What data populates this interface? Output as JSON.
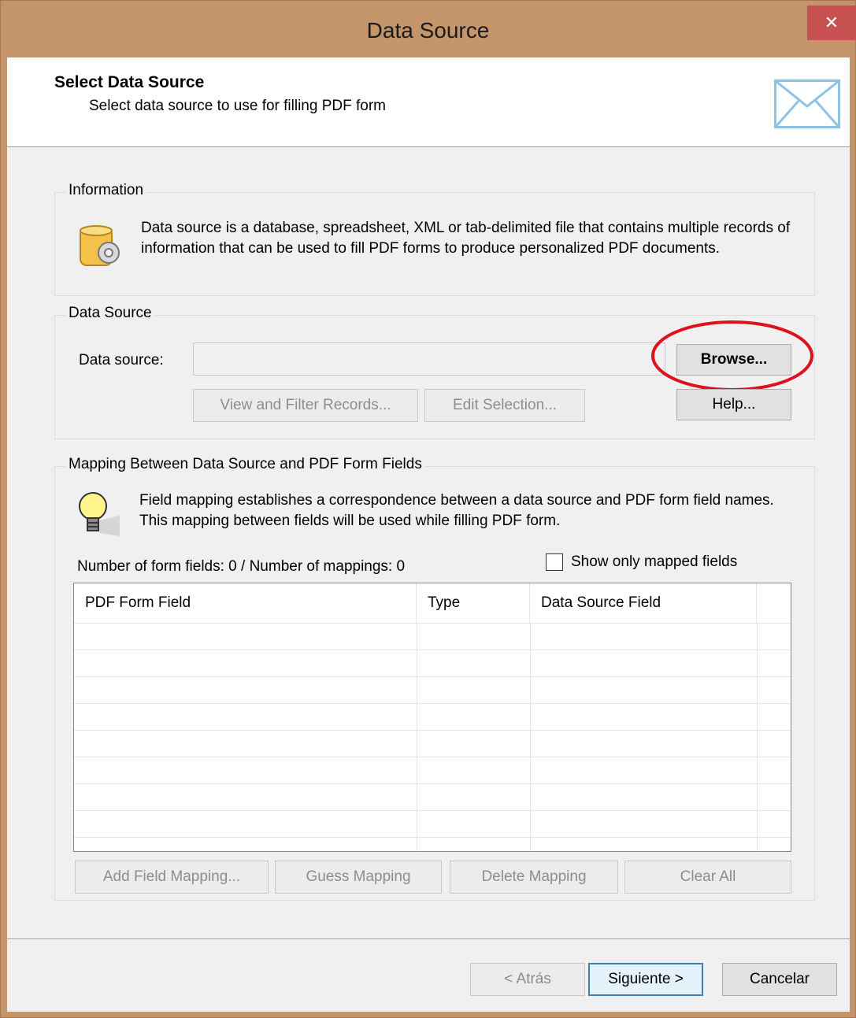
{
  "window": {
    "title": "Data Source",
    "close_symbol": "✕"
  },
  "header": {
    "title": "Select Data Source",
    "subtitle": "Select data source to use for filling PDF form",
    "icon": "envelope-icon"
  },
  "information": {
    "legend": "Information",
    "icon": "database-gear-icon",
    "text": "Data source is a database, spreadsheet, XML or tab-delimited file that contains multiple records of information that can be used to fill PDF forms to produce personalized PDF documents."
  },
  "data_source": {
    "legend": "Data Source",
    "field_label": "Data source:",
    "field_value": "",
    "browse_label": "Browse...",
    "help_label": "Help...",
    "view_filter_label": "View and Filter Records...",
    "edit_selection_label": "Edit Selection..."
  },
  "mapping": {
    "legend": "Mapping Between Data Source and PDF Form Fields",
    "icon": "lightbulb-icon",
    "text": "Field mapping establishes a correspondence between a data source and PDF form field names. This mapping between fields will be used while filling PDF form.",
    "count_text": "Number of form fields: 0 / Number of mappings: 0",
    "show_only_mapped_label": "Show only mapped fields",
    "show_only_mapped_checked": false,
    "columns": [
      "PDF Form Field",
      "Type",
      "Data Source Field"
    ],
    "rows": [],
    "add_label": "Add Field Mapping...",
    "guess_label": "Guess Mapping",
    "delete_label": "Delete Mapping",
    "clear_label": "Clear All"
  },
  "footer": {
    "back_label": "< Atrás",
    "next_label": "Siguiente >",
    "cancel_label": "Cancelar"
  },
  "colors": {
    "titlebar": "#c4946b",
    "close_button": "#c75050",
    "highlight_ellipse": "#e0101e",
    "accent_border": "#3c7fb1"
  }
}
